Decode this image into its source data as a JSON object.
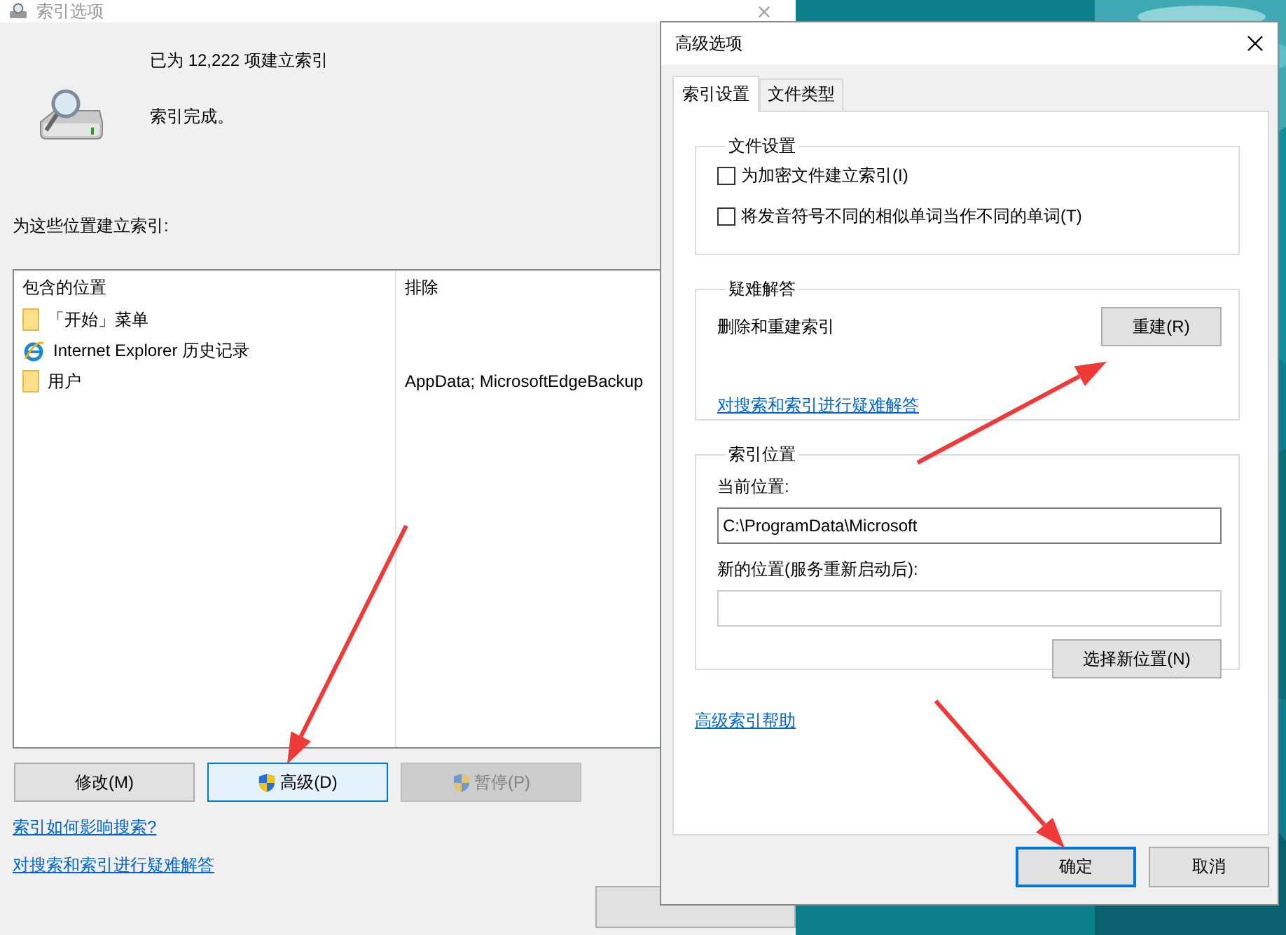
{
  "background_window": {
    "title": "索引选项",
    "status": "已为 12,222 项建立索引",
    "state": "索引完成。",
    "locations_label": "为这些位置建立索引:",
    "table": {
      "columns": [
        "包含的位置",
        "排除"
      ],
      "rows": [
        {
          "kind": "folder",
          "location": "「开始」菜单"
        },
        {
          "kind": "browser",
          "location": "Internet Explorer 历史记录"
        },
        {
          "kind": "folder",
          "location": "用户",
          "exclude": "AppData; MicrosoftEdgeBackup"
        }
      ]
    },
    "buttons": [
      {
        "label": "修改(M)",
        "shield": false,
        "focused": false,
        "disabled": false
      },
      {
        "label": "高级(D)",
        "shield": true,
        "focused": true,
        "disabled": false
      },
      {
        "label": "暂停(P)",
        "shield": true,
        "focused": false,
        "disabled": true
      }
    ],
    "links": [
      "索引如何影响搜索?",
      "对搜索和索引进行疑难解答"
    ]
  },
  "dialog": {
    "title": "高级选项",
    "tabs": [
      {
        "label": "索引设置",
        "selected": true
      },
      {
        "label": "文件类型",
        "selected": false
      }
    ],
    "file_settings": {
      "title": "文件设置",
      "options": [
        {
          "label": "为加密文件建立索引(I)",
          "checked": false
        },
        {
          "label": "将发音符号不同的相似单词当作不同的单词(T)",
          "checked": false
        }
      ]
    },
    "troubleshooting": {
      "title": "疑难解答",
      "text": "删除和重建索引",
      "button": "重建(R)",
      "link": "对搜索和索引进行疑难解答"
    },
    "index_location": {
      "title": "索引位置",
      "current_label": "当前位置:",
      "current_value": "C:\\ProgramData\\Microsoft",
      "new_label": "新的位置(服务重新启动后):",
      "button": "选择新位置(N)"
    },
    "help_link": "高级索引帮助",
    "buttons": [
      {
        "label": "确定",
        "default": true
      },
      {
        "label": "取消",
        "default": false
      }
    ]
  }
}
